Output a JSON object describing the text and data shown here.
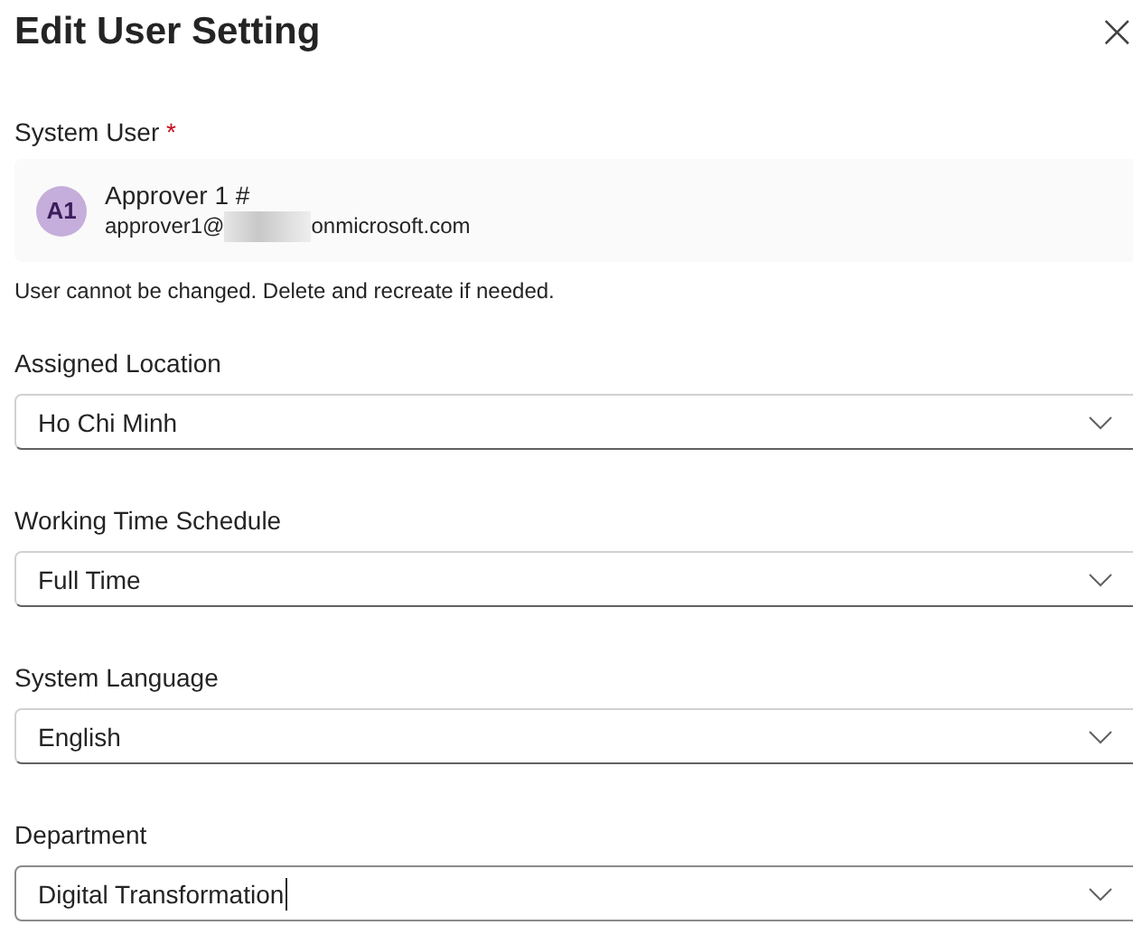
{
  "dialog": {
    "title": "Edit User Setting",
    "close": "×"
  },
  "system_user": {
    "label": "System User",
    "required_mark": "*",
    "avatar_initials": "A1",
    "name": "Approver 1 #",
    "email_start": "approver1@",
    "email_end": "onmicrosoft.com",
    "email_redacted": true,
    "helper": "User cannot be changed. Delete and recreate if needed."
  },
  "fields": [
    {
      "label": "Assigned Location",
      "value": "Ho Chi Minh",
      "focused": false
    },
    {
      "label": "Working Time Schedule",
      "value": "Full Time",
      "focused": false
    },
    {
      "label": "System Language",
      "value": "English",
      "focused": false
    },
    {
      "label": "Department",
      "value": "Digital Transformation",
      "focused": true
    }
  ]
}
